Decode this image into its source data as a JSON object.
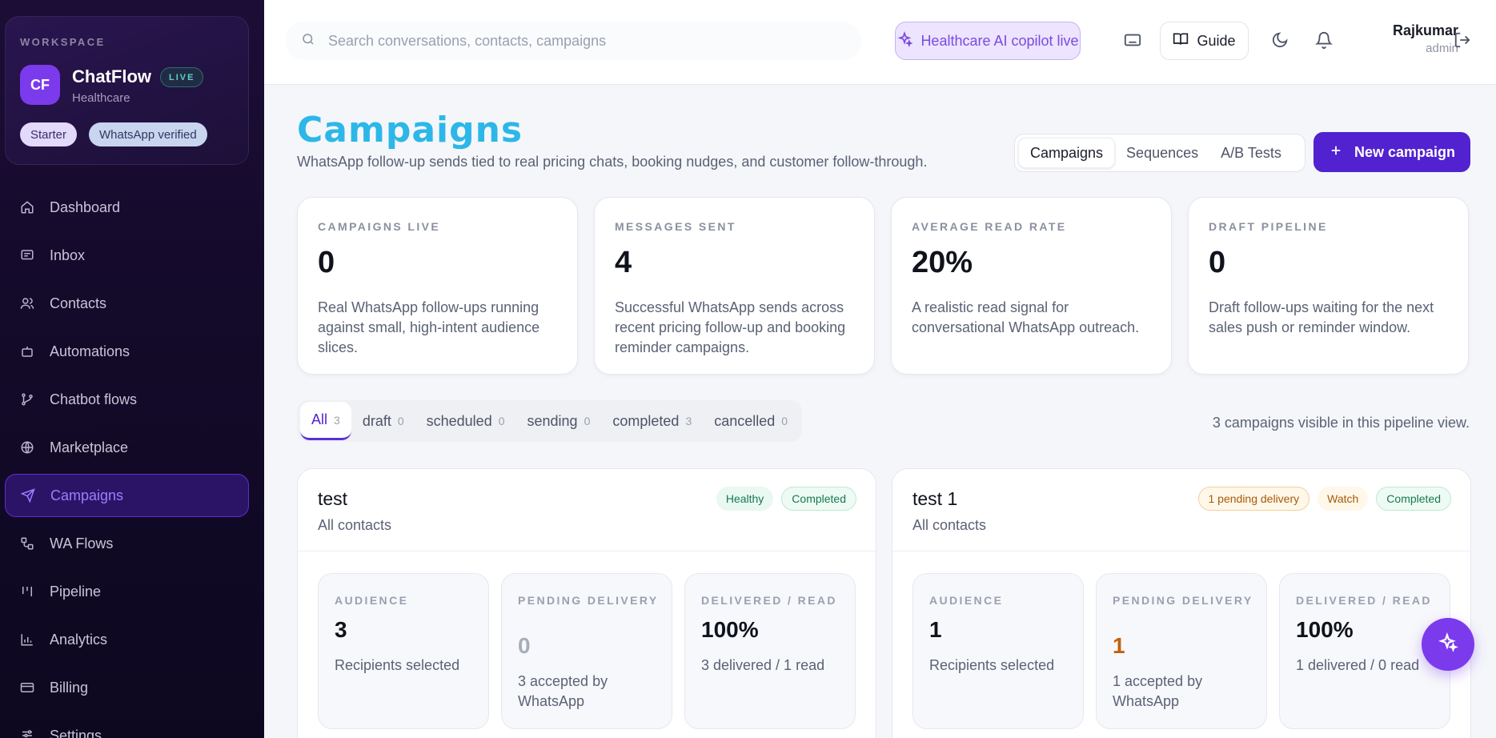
{
  "workspace": {
    "label": "WORKSPACE",
    "initials": "CF",
    "name": "ChatFlow",
    "live_badge": "LIVE",
    "sub": "Healthcare",
    "plan": "Starter",
    "verified": "WhatsApp verified"
  },
  "nav": {
    "items": [
      {
        "label": "Dashboard",
        "icon": "home-icon"
      },
      {
        "label": "Inbox",
        "icon": "message-icon"
      },
      {
        "label": "Contacts",
        "icon": "users-icon"
      },
      {
        "label": "Automations",
        "icon": "bot-icon"
      },
      {
        "label": "Chatbot flows",
        "icon": "git-branch-icon"
      },
      {
        "label": "Marketplace",
        "icon": "globe-icon"
      },
      {
        "label": "Campaigns",
        "icon": "send-icon",
        "active": true
      },
      {
        "label": "WA Flows",
        "icon": "workflow-icon"
      },
      {
        "label": "Pipeline",
        "icon": "kanban-icon"
      },
      {
        "label": "Analytics",
        "icon": "bar-chart-icon"
      },
      {
        "label": "Billing",
        "icon": "credit-card-icon"
      },
      {
        "label": "Settings",
        "icon": "settings-icon"
      }
    ]
  },
  "topbar": {
    "search_placeholder": "Search conversations, contacts, campaigns",
    "copilot_label": "Healthcare AI copilot live",
    "guide_label": "Guide",
    "user_name": "Rajkumar",
    "user_role": "admin"
  },
  "page": {
    "title": "Campaigns",
    "subtitle": "WhatsApp follow-up sends tied to real pricing chats, booking nudges, and customer follow-through.",
    "segments": [
      "Campaigns",
      "Sequences",
      "A/B Tests"
    ],
    "active_segment": "Campaigns",
    "new_button": "New campaign"
  },
  "stats": [
    {
      "label": "CAMPAIGNS LIVE",
      "value": "0",
      "desc": "Real WhatsApp follow-ups running against small, high-intent audience slices."
    },
    {
      "label": "MESSAGES SENT",
      "value": "4",
      "desc": "Successful WhatsApp sends across recent pricing follow-up and booking reminder campaigns."
    },
    {
      "label": "AVERAGE READ RATE",
      "value": "20%",
      "desc": "A realistic read signal for conversational WhatsApp outreach."
    },
    {
      "label": "DRAFT PIPELINE",
      "value": "0",
      "desc": "Draft follow-ups waiting for the next sales push or reminder window."
    }
  ],
  "filters": [
    {
      "label": "All",
      "count": "3",
      "active": true
    },
    {
      "label": "draft",
      "count": "0"
    },
    {
      "label": "scheduled",
      "count": "0"
    },
    {
      "label": "sending",
      "count": "0"
    },
    {
      "label": "completed",
      "count": "3"
    },
    {
      "label": "cancelled",
      "count": "0"
    }
  ],
  "pipeline_note": "3 campaigns visible in this pipeline view.",
  "campaigns": [
    {
      "name": "test",
      "audience": "All contacts",
      "badges": [
        "Healthy",
        "Completed"
      ],
      "audience_label": "AUDIENCE",
      "audience_value": "3",
      "audience_desc": "Recipients selected",
      "pending_label": "PENDING DELIVERY",
      "pending_value": "0",
      "pending_desc": "3 accepted by WhatsApp",
      "delivered_label": "DELIVERED / READ",
      "delivered_value": "100%",
      "delivered_desc": "3 delivered / 1 read"
    },
    {
      "name": "test 1",
      "audience": "All contacts",
      "badges": [
        "1 pending delivery",
        "Watch",
        "Completed"
      ],
      "audience_label": "AUDIENCE",
      "audience_value": "1",
      "audience_desc": "Recipients selected",
      "pending_label": "PENDING DELIVERY",
      "pending_value": "1",
      "pending_desc": "1 accepted by WhatsApp",
      "delivered_label": "DELIVERED / READ",
      "delivered_value": "100%",
      "delivered_desc": "1 delivered / 0 read"
    }
  ],
  "colors": {
    "accent": "#5222d0",
    "title": "#2cb7e8",
    "sidebar_bg": "#140a2a",
    "active_nav": "#a07bff"
  }
}
